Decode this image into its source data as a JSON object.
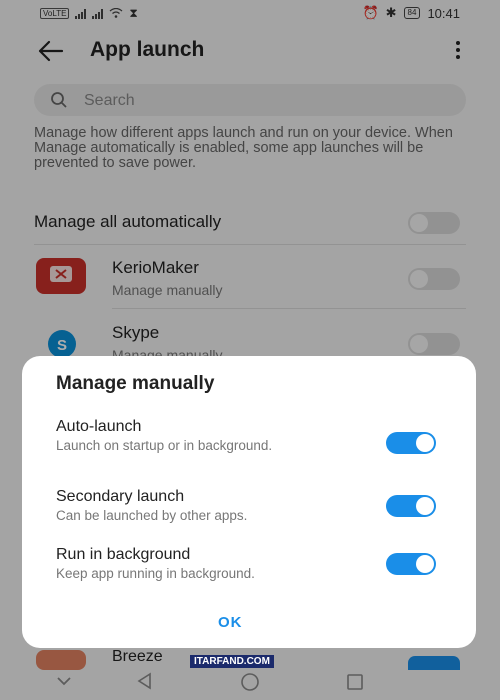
{
  "status": {
    "network": "VoLTE",
    "time": "10:41",
    "battery": "84"
  },
  "header": {
    "title": "App launch"
  },
  "search": {
    "placeholder": "Search"
  },
  "description": "Manage how different apps launch and run on your device. When Manage automatically is enabled, some app launches will be prevented to save power.",
  "manage_all": {
    "label": "Manage all automatically"
  },
  "apps": [
    {
      "name": "KerioMaker",
      "status": "Manage manually",
      "icon_color": "#c8302a"
    },
    {
      "name": "Skype",
      "status": "Manage manually",
      "icon_color": "#0a8fd8"
    },
    {
      "name": "Breeze",
      "status": "",
      "icon_color": "#e08060"
    }
  ],
  "dialog": {
    "title": "Manage manually",
    "options": [
      {
        "title": "Auto-launch",
        "subtitle": "Launch on startup or in background.",
        "enabled": true
      },
      {
        "title": "Secondary launch",
        "subtitle": "Can be launched by other apps.",
        "enabled": true
      },
      {
        "title": "Run in background",
        "subtitle": "Keep app running in background.",
        "enabled": true
      }
    ],
    "ok_label": "OK"
  },
  "peek_label": "Breeze",
  "watermark": "ITARFAND.COM",
  "colors": {
    "accent": "#1a8ee8",
    "toggle_off": "#d8d8d8"
  }
}
